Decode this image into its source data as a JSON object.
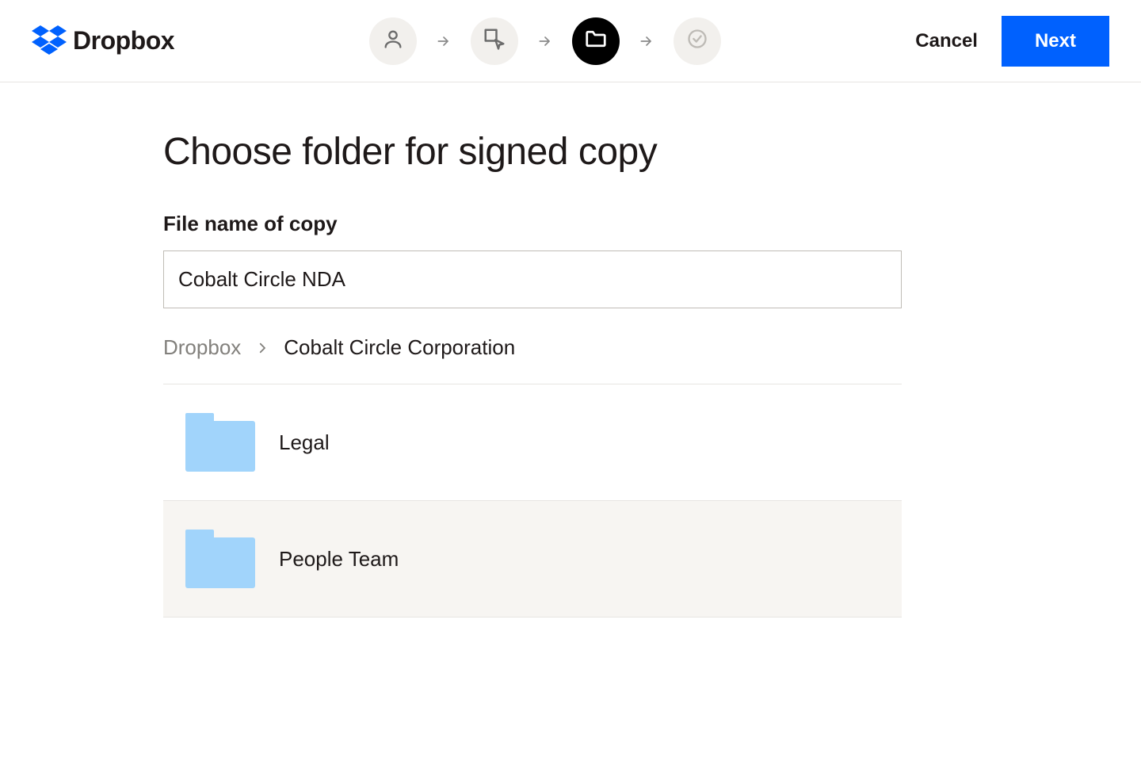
{
  "header": {
    "brand": "Dropbox",
    "cancel_label": "Cancel",
    "next_label": "Next"
  },
  "main": {
    "title": "Choose folder for signed copy",
    "filename_label": "File name of copy",
    "filename_value": "Cobalt Circle NDA"
  },
  "breadcrumb": {
    "root": "Dropbox",
    "current": "Cobalt Circle Corporation"
  },
  "folders": [
    {
      "name": "Legal",
      "selected": false
    },
    {
      "name": "People Team",
      "selected": true
    }
  ]
}
